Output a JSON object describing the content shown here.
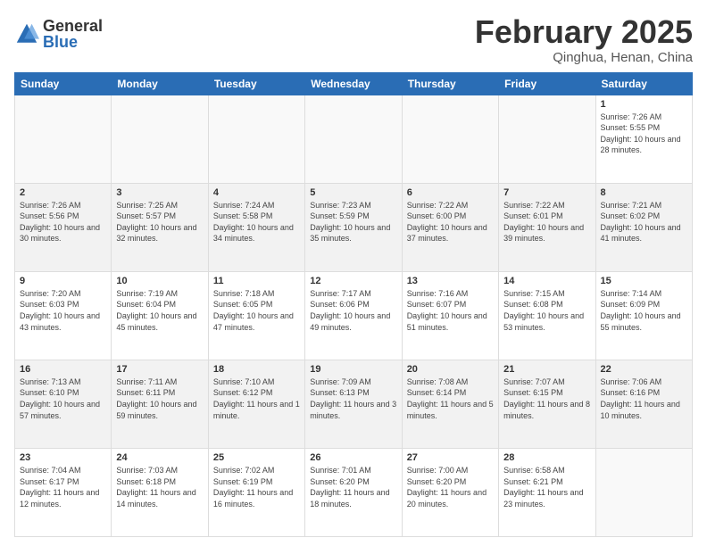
{
  "header": {
    "logo": {
      "general": "General",
      "blue": "Blue"
    },
    "title": "February 2025",
    "subtitle": "Qinghua, Henan, China"
  },
  "weekdays": [
    "Sunday",
    "Monday",
    "Tuesday",
    "Wednesday",
    "Thursday",
    "Friday",
    "Saturday"
  ],
  "weeks": [
    [
      {
        "day": "",
        "info": ""
      },
      {
        "day": "",
        "info": ""
      },
      {
        "day": "",
        "info": ""
      },
      {
        "day": "",
        "info": ""
      },
      {
        "day": "",
        "info": ""
      },
      {
        "day": "",
        "info": ""
      },
      {
        "day": "1",
        "info": "Sunrise: 7:26 AM\nSunset: 5:55 PM\nDaylight: 10 hours and 28 minutes."
      }
    ],
    [
      {
        "day": "2",
        "info": "Sunrise: 7:26 AM\nSunset: 5:56 PM\nDaylight: 10 hours and 30 minutes."
      },
      {
        "day": "3",
        "info": "Sunrise: 7:25 AM\nSunset: 5:57 PM\nDaylight: 10 hours and 32 minutes."
      },
      {
        "day": "4",
        "info": "Sunrise: 7:24 AM\nSunset: 5:58 PM\nDaylight: 10 hours and 34 minutes."
      },
      {
        "day": "5",
        "info": "Sunrise: 7:23 AM\nSunset: 5:59 PM\nDaylight: 10 hours and 35 minutes."
      },
      {
        "day": "6",
        "info": "Sunrise: 7:22 AM\nSunset: 6:00 PM\nDaylight: 10 hours and 37 minutes."
      },
      {
        "day": "7",
        "info": "Sunrise: 7:22 AM\nSunset: 6:01 PM\nDaylight: 10 hours and 39 minutes."
      },
      {
        "day": "8",
        "info": "Sunrise: 7:21 AM\nSunset: 6:02 PM\nDaylight: 10 hours and 41 minutes."
      }
    ],
    [
      {
        "day": "9",
        "info": "Sunrise: 7:20 AM\nSunset: 6:03 PM\nDaylight: 10 hours and 43 minutes."
      },
      {
        "day": "10",
        "info": "Sunrise: 7:19 AM\nSunset: 6:04 PM\nDaylight: 10 hours and 45 minutes."
      },
      {
        "day": "11",
        "info": "Sunrise: 7:18 AM\nSunset: 6:05 PM\nDaylight: 10 hours and 47 minutes."
      },
      {
        "day": "12",
        "info": "Sunrise: 7:17 AM\nSunset: 6:06 PM\nDaylight: 10 hours and 49 minutes."
      },
      {
        "day": "13",
        "info": "Sunrise: 7:16 AM\nSunset: 6:07 PM\nDaylight: 10 hours and 51 minutes."
      },
      {
        "day": "14",
        "info": "Sunrise: 7:15 AM\nSunset: 6:08 PM\nDaylight: 10 hours and 53 minutes."
      },
      {
        "day": "15",
        "info": "Sunrise: 7:14 AM\nSunset: 6:09 PM\nDaylight: 10 hours and 55 minutes."
      }
    ],
    [
      {
        "day": "16",
        "info": "Sunrise: 7:13 AM\nSunset: 6:10 PM\nDaylight: 10 hours and 57 minutes."
      },
      {
        "day": "17",
        "info": "Sunrise: 7:11 AM\nSunset: 6:11 PM\nDaylight: 10 hours and 59 minutes."
      },
      {
        "day": "18",
        "info": "Sunrise: 7:10 AM\nSunset: 6:12 PM\nDaylight: 11 hours and 1 minute."
      },
      {
        "day": "19",
        "info": "Sunrise: 7:09 AM\nSunset: 6:13 PM\nDaylight: 11 hours and 3 minutes."
      },
      {
        "day": "20",
        "info": "Sunrise: 7:08 AM\nSunset: 6:14 PM\nDaylight: 11 hours and 5 minutes."
      },
      {
        "day": "21",
        "info": "Sunrise: 7:07 AM\nSunset: 6:15 PM\nDaylight: 11 hours and 8 minutes."
      },
      {
        "day": "22",
        "info": "Sunrise: 7:06 AM\nSunset: 6:16 PM\nDaylight: 11 hours and 10 minutes."
      }
    ],
    [
      {
        "day": "23",
        "info": "Sunrise: 7:04 AM\nSunset: 6:17 PM\nDaylight: 11 hours and 12 minutes."
      },
      {
        "day": "24",
        "info": "Sunrise: 7:03 AM\nSunset: 6:18 PM\nDaylight: 11 hours and 14 minutes."
      },
      {
        "day": "25",
        "info": "Sunrise: 7:02 AM\nSunset: 6:19 PM\nDaylight: 11 hours and 16 minutes."
      },
      {
        "day": "26",
        "info": "Sunrise: 7:01 AM\nSunset: 6:20 PM\nDaylight: 11 hours and 18 minutes."
      },
      {
        "day": "27",
        "info": "Sunrise: 7:00 AM\nSunset: 6:20 PM\nDaylight: 11 hours and 20 minutes."
      },
      {
        "day": "28",
        "info": "Sunrise: 6:58 AM\nSunset: 6:21 PM\nDaylight: 11 hours and 23 minutes."
      },
      {
        "day": "",
        "info": ""
      }
    ]
  ]
}
